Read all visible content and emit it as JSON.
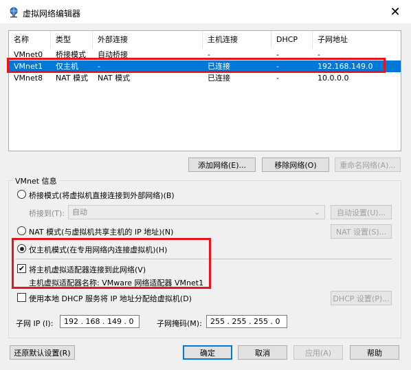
{
  "window": {
    "title": "虚拟网络编辑器",
    "close_glyph": "✕"
  },
  "table": {
    "headers": [
      "名称",
      "类型",
      "外部连接",
      "主机连接",
      "DHCP",
      "子网地址"
    ],
    "rows": [
      [
        "VMnet0",
        "桥接模式",
        "自动桥接",
        "-",
        "-",
        "-"
      ],
      [
        "VMnet1",
        "仅主机",
        "-",
        "已连接",
        "-",
        "192.168.149.0"
      ],
      [
        "VMnet8",
        "NAT 模式",
        "NAT 模式",
        "已连接",
        "-",
        "10.0.0.0"
      ]
    ],
    "selected_row": 1
  },
  "table_buttons": {
    "add": "添加网络(E)...",
    "remove": "移除网络(O)",
    "rename": "重命名网络(A)..."
  },
  "vmnet_info": {
    "title": "VMnet 信息",
    "bridged_label": "桥接模式(将虚拟机直接连接到外部网络)(B)",
    "bridge_to_label": "桥接到(T):",
    "bridge_to_value": "自动",
    "auto_settings": "自动设置(U)...",
    "nat_label": "NAT 模式(与虚拟机共享主机的 IP 地址)(N)",
    "nat_settings": "NAT 设置(S)...",
    "hostonly_label": "仅主机模式(在专用网络内连接虚拟机)(H)",
    "connect_adapter_label": "将主机虚拟适配器连接到此网络(V)",
    "adapter_name_text": "主机虚拟适配器名称: VMware 网络适配器 VMnet1",
    "dhcp_label": "使用本地 DHCP 服务将 IP 地址分配给虚拟机(D)",
    "dhcp_settings": "DHCP 设置(P)...",
    "subnet_ip_label": "子网 IP (I):",
    "subnet_ip_value": "192 . 168 . 149 . 0",
    "subnet_mask_label": "子网掩码(M):",
    "subnet_mask_value": "255 . 255 . 255 . 0",
    "mode_selected": "host-only",
    "connect_adapter_checked": true,
    "dhcp_checked": false
  },
  "footer": {
    "restore": "还原默认设置(R)",
    "ok": "确定",
    "cancel": "取消",
    "apply": "应用(A)",
    "help": "帮助"
  },
  "colors": {
    "selection": "#0078d7",
    "highlight_box": "#e8141b"
  }
}
